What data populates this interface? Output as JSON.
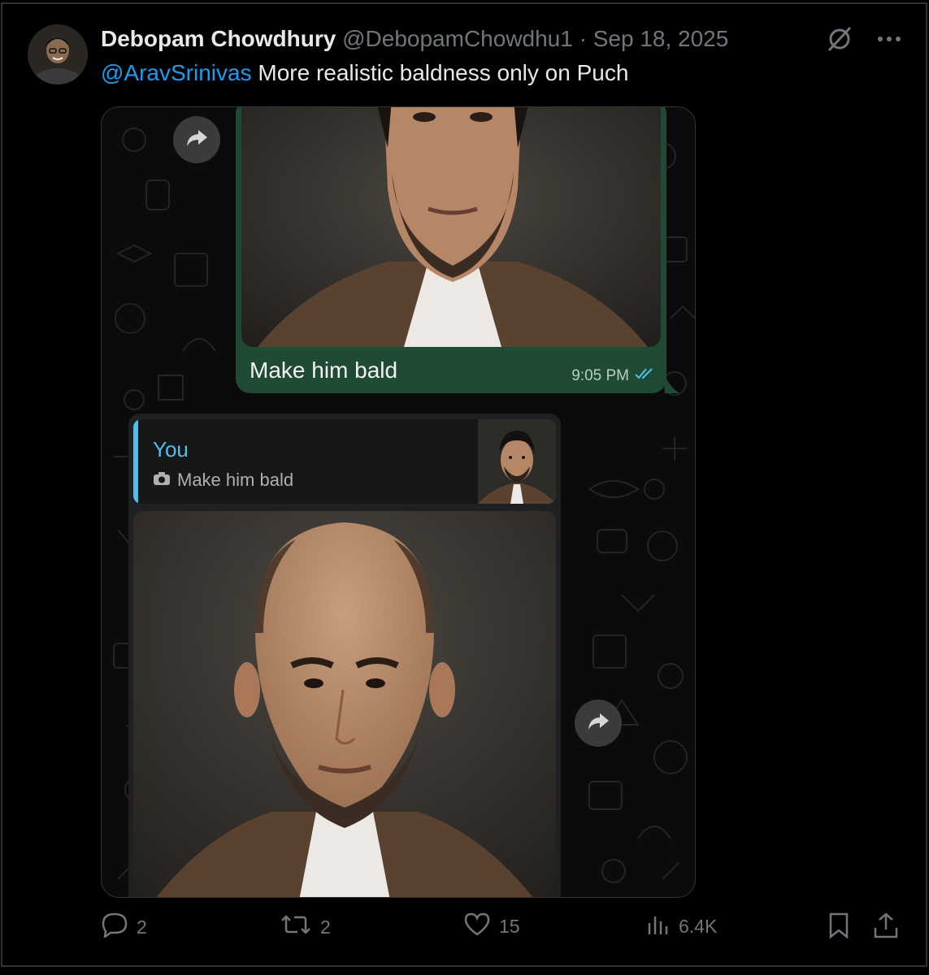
{
  "author": {
    "name": "Debopam Chowdhury",
    "handle": "@DebopamChowdhu1",
    "separator": "·",
    "date": "Sep 18, 2025"
  },
  "tweet": {
    "mention": "@AravSrinivas",
    "text": " More realistic baldness only on Puch"
  },
  "chat": {
    "sent_caption": "Make him bald",
    "sent_time": "9:05 PM",
    "reply_title": "You",
    "reply_text": "Make him bald"
  },
  "actions": {
    "replies": "2",
    "reposts": "2",
    "likes": "15",
    "views": "6.4K"
  },
  "colors": {
    "background": "#000000",
    "mention": "#1d9bf0",
    "muted": "#71767b",
    "sent_bubble": "#1f4a34",
    "reply_accent": "#53bdeb"
  },
  "icons": [
    "grok-icon",
    "more-icon",
    "forward-icon",
    "double-check-icon",
    "camera-icon",
    "reply-icon",
    "repost-icon",
    "like-icon",
    "views-icon",
    "bookmark-icon",
    "share-icon"
  ]
}
